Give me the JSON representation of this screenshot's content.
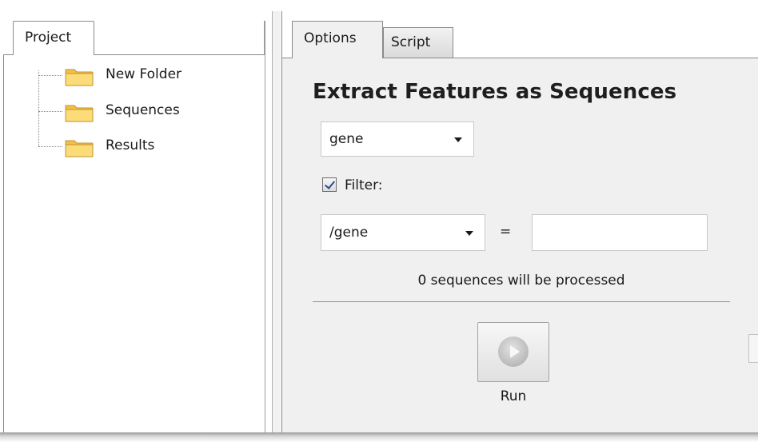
{
  "project_panel": {
    "tab_label": "Project",
    "tree": [
      {
        "label": "New Folder",
        "icon": "folder-icon"
      },
      {
        "label": "Sequences",
        "icon": "folder-icon"
      },
      {
        "label": "Results",
        "icon": "folder-icon"
      }
    ]
  },
  "tabs": [
    {
      "label": "Options",
      "active": true
    },
    {
      "label": "Script",
      "active": false
    }
  ],
  "options": {
    "title": "Extract Features as Sequences",
    "feature_type": {
      "value": "gene"
    },
    "filter": {
      "checked": true,
      "label": "Filter:"
    },
    "qualifier": {
      "value": "/gene"
    },
    "equals": "=",
    "filter_value": "",
    "status": "0 sequences will be processed",
    "run": {
      "label": "Run",
      "icon": "play-icon"
    }
  },
  "colors": {
    "folder_yellow": "#f5c94a",
    "panel_background": "#f0f0f0",
    "check_blue": "#2b4d8c"
  }
}
